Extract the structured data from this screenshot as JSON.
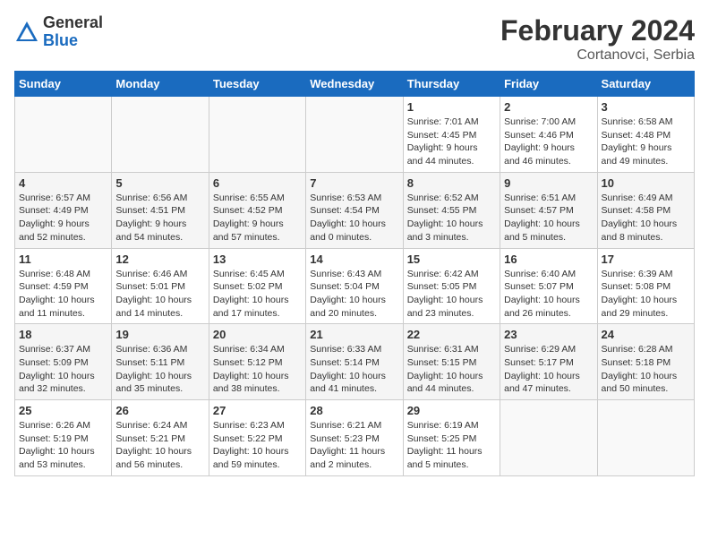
{
  "header": {
    "logo_general": "General",
    "logo_blue": "Blue",
    "title": "February 2024",
    "subtitle": "Cortanovci, Serbia"
  },
  "days_of_week": [
    "Sunday",
    "Monday",
    "Tuesday",
    "Wednesday",
    "Thursday",
    "Friday",
    "Saturday"
  ],
  "weeks": [
    [
      {
        "day": "",
        "info": ""
      },
      {
        "day": "",
        "info": ""
      },
      {
        "day": "",
        "info": ""
      },
      {
        "day": "",
        "info": ""
      },
      {
        "day": "1",
        "info": "Sunrise: 7:01 AM\nSunset: 4:45 PM\nDaylight: 9 hours\nand 44 minutes."
      },
      {
        "day": "2",
        "info": "Sunrise: 7:00 AM\nSunset: 4:46 PM\nDaylight: 9 hours\nand 46 minutes."
      },
      {
        "day": "3",
        "info": "Sunrise: 6:58 AM\nSunset: 4:48 PM\nDaylight: 9 hours\nand 49 minutes."
      }
    ],
    [
      {
        "day": "4",
        "info": "Sunrise: 6:57 AM\nSunset: 4:49 PM\nDaylight: 9 hours\nand 52 minutes."
      },
      {
        "day": "5",
        "info": "Sunrise: 6:56 AM\nSunset: 4:51 PM\nDaylight: 9 hours\nand 54 minutes."
      },
      {
        "day": "6",
        "info": "Sunrise: 6:55 AM\nSunset: 4:52 PM\nDaylight: 9 hours\nand 57 minutes."
      },
      {
        "day": "7",
        "info": "Sunrise: 6:53 AM\nSunset: 4:54 PM\nDaylight: 10 hours\nand 0 minutes."
      },
      {
        "day": "8",
        "info": "Sunrise: 6:52 AM\nSunset: 4:55 PM\nDaylight: 10 hours\nand 3 minutes."
      },
      {
        "day": "9",
        "info": "Sunrise: 6:51 AM\nSunset: 4:57 PM\nDaylight: 10 hours\nand 5 minutes."
      },
      {
        "day": "10",
        "info": "Sunrise: 6:49 AM\nSunset: 4:58 PM\nDaylight: 10 hours\nand 8 minutes."
      }
    ],
    [
      {
        "day": "11",
        "info": "Sunrise: 6:48 AM\nSunset: 4:59 PM\nDaylight: 10 hours\nand 11 minutes."
      },
      {
        "day": "12",
        "info": "Sunrise: 6:46 AM\nSunset: 5:01 PM\nDaylight: 10 hours\nand 14 minutes."
      },
      {
        "day": "13",
        "info": "Sunrise: 6:45 AM\nSunset: 5:02 PM\nDaylight: 10 hours\nand 17 minutes."
      },
      {
        "day": "14",
        "info": "Sunrise: 6:43 AM\nSunset: 5:04 PM\nDaylight: 10 hours\nand 20 minutes."
      },
      {
        "day": "15",
        "info": "Sunrise: 6:42 AM\nSunset: 5:05 PM\nDaylight: 10 hours\nand 23 minutes."
      },
      {
        "day": "16",
        "info": "Sunrise: 6:40 AM\nSunset: 5:07 PM\nDaylight: 10 hours\nand 26 minutes."
      },
      {
        "day": "17",
        "info": "Sunrise: 6:39 AM\nSunset: 5:08 PM\nDaylight: 10 hours\nand 29 minutes."
      }
    ],
    [
      {
        "day": "18",
        "info": "Sunrise: 6:37 AM\nSunset: 5:09 PM\nDaylight: 10 hours\nand 32 minutes."
      },
      {
        "day": "19",
        "info": "Sunrise: 6:36 AM\nSunset: 5:11 PM\nDaylight: 10 hours\nand 35 minutes."
      },
      {
        "day": "20",
        "info": "Sunrise: 6:34 AM\nSunset: 5:12 PM\nDaylight: 10 hours\nand 38 minutes."
      },
      {
        "day": "21",
        "info": "Sunrise: 6:33 AM\nSunset: 5:14 PM\nDaylight: 10 hours\nand 41 minutes."
      },
      {
        "day": "22",
        "info": "Sunrise: 6:31 AM\nSunset: 5:15 PM\nDaylight: 10 hours\nand 44 minutes."
      },
      {
        "day": "23",
        "info": "Sunrise: 6:29 AM\nSunset: 5:17 PM\nDaylight: 10 hours\nand 47 minutes."
      },
      {
        "day": "24",
        "info": "Sunrise: 6:28 AM\nSunset: 5:18 PM\nDaylight: 10 hours\nand 50 minutes."
      }
    ],
    [
      {
        "day": "25",
        "info": "Sunrise: 6:26 AM\nSunset: 5:19 PM\nDaylight: 10 hours\nand 53 minutes."
      },
      {
        "day": "26",
        "info": "Sunrise: 6:24 AM\nSunset: 5:21 PM\nDaylight: 10 hours\nand 56 minutes."
      },
      {
        "day": "27",
        "info": "Sunrise: 6:23 AM\nSunset: 5:22 PM\nDaylight: 10 hours\nand 59 minutes."
      },
      {
        "day": "28",
        "info": "Sunrise: 6:21 AM\nSunset: 5:23 PM\nDaylight: 11 hours\nand 2 minutes."
      },
      {
        "day": "29",
        "info": "Sunrise: 6:19 AM\nSunset: 5:25 PM\nDaylight: 11 hours\nand 5 minutes."
      },
      {
        "day": "",
        "info": ""
      },
      {
        "day": "",
        "info": ""
      }
    ]
  ]
}
